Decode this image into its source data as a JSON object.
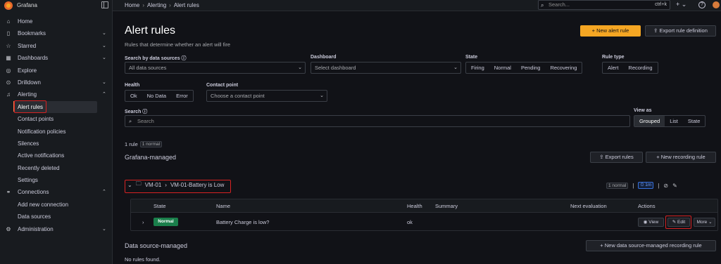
{
  "app": {
    "name": "Grafana"
  },
  "breadcrumb": [
    "Home",
    "Alerting",
    "Alert rules"
  ],
  "topbar": {
    "search_placeholder": "Search...",
    "shortcut": "ctrl+k",
    "plus": "+",
    "help": "?"
  },
  "sidebar": {
    "items": [
      {
        "label": "Home",
        "icon": "home-icon"
      },
      {
        "label": "Bookmarks",
        "icon": "bookmark-icon",
        "chevron": "⌄"
      },
      {
        "label": "Starred",
        "icon": "star-icon",
        "chevron": "⌄"
      },
      {
        "label": "Dashboards",
        "icon": "apps-icon",
        "chevron": "⌄"
      },
      {
        "label": "Explore",
        "icon": "compass-icon"
      },
      {
        "label": "Drilldown",
        "icon": "drilldown-icon",
        "chevron": "⌄"
      },
      {
        "label": "Alerting",
        "icon": "bell-icon",
        "chevron": "⌃"
      },
      {
        "label": "Alert rules",
        "sub": true,
        "active": true
      },
      {
        "label": "Contact points",
        "sub": true
      },
      {
        "label": "Notification policies",
        "sub": true
      },
      {
        "label": "Silences",
        "sub": true
      },
      {
        "label": "Active notifications",
        "sub": true
      },
      {
        "label": "Recently deleted",
        "sub": true
      },
      {
        "label": "Settings",
        "sub": true
      },
      {
        "label": "Connections",
        "icon": "plug-icon",
        "chevron": "⌃"
      },
      {
        "label": "Add new connection",
        "sub": true
      },
      {
        "label": "Data sources",
        "sub": true
      },
      {
        "label": "Administration",
        "icon": "cog-icon",
        "chevron": "⌄"
      }
    ]
  },
  "page": {
    "title": "Alert rules",
    "subtitle": "Rules that determine whether an alert will fire",
    "new_rule": "+ New alert rule",
    "export_def": "Export rule definition"
  },
  "filters": {
    "datasource_label": "Search by data sources ⓘ",
    "datasource_value": "All data sources",
    "dashboard_label": "Dashboard",
    "dashboard_value": "Select dashboard",
    "state_label": "State",
    "state_options": [
      "Firing",
      "Normal",
      "Pending",
      "Recovering"
    ],
    "ruletype_label": "Rule type",
    "ruletype_options": [
      "Alert",
      "Recording"
    ],
    "health_label": "Health",
    "health_options": [
      "Ok",
      "No Data",
      "Error"
    ],
    "contact_label": "Contact point",
    "contact_value": "Choose a contact point",
    "search_label": "Search ⓘ",
    "search_placeholder": "Search",
    "viewas_label": "View as",
    "viewas_options": [
      "Grouped",
      "List",
      "State"
    ]
  },
  "summary": {
    "count": "1 rule",
    "badge": "1 normal"
  },
  "grafana_managed": {
    "title": "Grafana-managed",
    "export_btn": "Export rules",
    "new_recording_btn": "+ New recording rule",
    "folder": "VM-01",
    "group": "VM-01-Battery is Low",
    "normal_badge": "1 normal",
    "interval": "1m"
  },
  "table": {
    "headers": [
      "State",
      "Name",
      "Health",
      "Summary",
      "Next evaluation",
      "Actions"
    ],
    "row": {
      "state": "Normal",
      "name": "Battery Charge is low?",
      "health": "ok",
      "view": "View",
      "edit": "Edit",
      "more": "More"
    }
  },
  "datasource_managed": {
    "title": "Data source-managed",
    "new_btn": "+ New data source-managed recording rule",
    "empty": "No rules found."
  }
}
